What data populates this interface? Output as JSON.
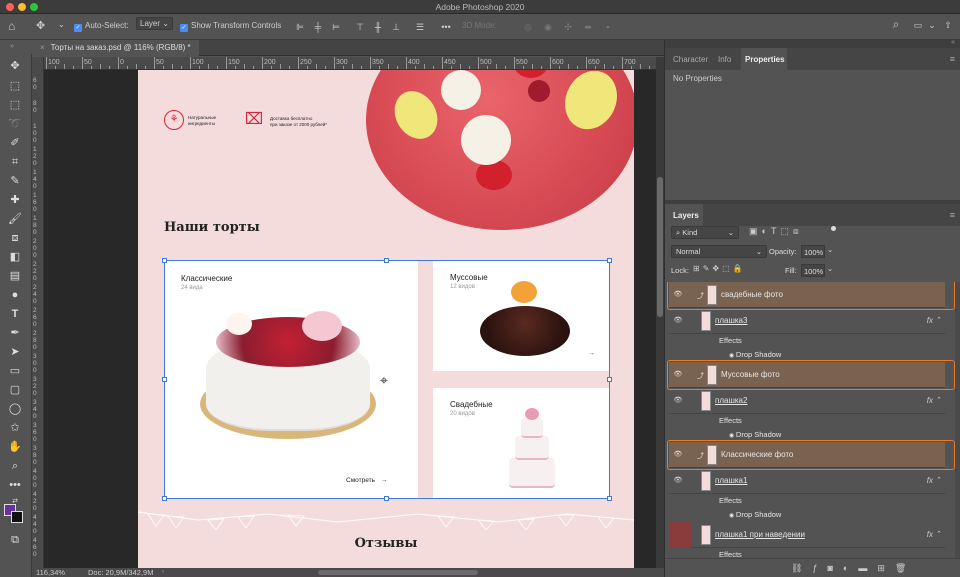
{
  "app": {
    "title": "Adobe Photoshop 2020"
  },
  "options_bar": {
    "auto_select_label": "Auto-Select:",
    "auto_select_value": "Layer",
    "show_transform_label": "Show Transform Controls",
    "mode_3d_label": "3D Mode:"
  },
  "document": {
    "tab_title": "Торты на заказ.psd @ 116% (RGB/8) *",
    "ruler_h": [
      "200",
      "150",
      "100",
      "50",
      "0",
      "50",
      "100",
      "150",
      "200",
      "250",
      "300",
      "350",
      "400",
      "450",
      "500",
      "550",
      "600",
      "650",
      "700",
      "750",
      "800",
      "850",
      "900",
      "950"
    ],
    "ruler_v": [
      "6\n0",
      "8\n0",
      "1\n0\n0",
      "1\n2\n0",
      "1\n4\n0",
      "1\n6\n0",
      "1\n8\n0",
      "2\n0\n0",
      "2\n2\n0",
      "2\n4\n0",
      "2\n6\n0",
      "2\n8\n0",
      "3\n0\n0",
      "3\n2\n0",
      "3\n4\n0",
      "3\n6\n0",
      "3\n8\n0",
      "4\n0\n0",
      "4\n2\n0",
      "4\n4\n0",
      "4\n6\n0"
    ]
  },
  "status": {
    "zoom": "116,34%",
    "doc": "Doc: 20,9M/342,9M"
  },
  "artboard": {
    "feature1": "Натуральные ингредиенты",
    "feature2_line1": "Доставка бесплатно",
    "feature2_line2": "при заказе от 2000 рублей*",
    "section_title": "Наши торты",
    "card_classic_title": "Классические",
    "card_classic_count": "24 вида",
    "card_classic_link": "Смотреть",
    "card_mousse_title": "Муссовые",
    "card_mousse_count": "12 видов",
    "card_wedding_title": "Свадебные",
    "card_wedding_count": "20 видов",
    "reviews_title": "Отзывы",
    "arrow": "→"
  },
  "panels": {
    "top_tabs": [
      "Character",
      "Info",
      "Properties"
    ],
    "active_top_tab": "Properties",
    "properties_empty": "No Properties",
    "layers_tab": "Layers",
    "filter_kind": "Kind",
    "blend_mode": "Normal",
    "opacity_label": "Opacity:",
    "opacity_value": "100%",
    "lock_label": "Lock:",
    "fill_label": "Fill:",
    "fill_value": "100%"
  },
  "layers": [
    {
      "name": "свадебные фото",
      "highlighted": true
    },
    {
      "name": "плашка3",
      "fx": "fx"
    },
    {
      "name": "Effects"
    },
    {
      "name": "Drop Shadow"
    },
    {
      "name": "Муссовые фото",
      "highlighted": true
    },
    {
      "name": "плашка2",
      "fx": "fx"
    },
    {
      "name": "Effects"
    },
    {
      "name": "Drop Shadow"
    },
    {
      "name": "Классические фото",
      "highlighted": true
    },
    {
      "name": "плашка1",
      "fx": "fx"
    },
    {
      "name": "Effects"
    },
    {
      "name": "Drop Shadow"
    },
    {
      "name": "плашка1 при наведении",
      "fx": "fx"
    },
    {
      "name": "Effects"
    }
  ],
  "colors": {
    "highlight": "#f07a21",
    "accent": "#d6243b",
    "selection": "#3d7bd9"
  }
}
